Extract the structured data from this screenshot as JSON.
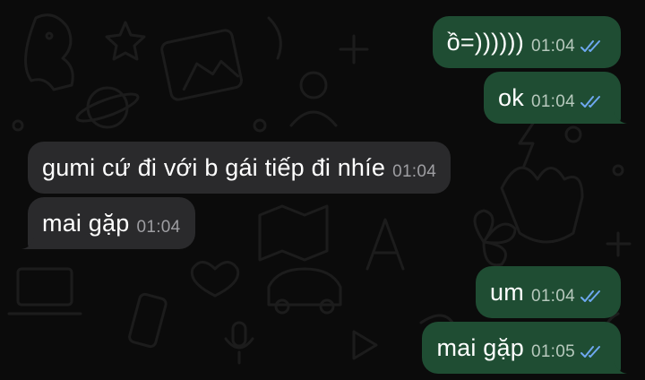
{
  "colors": {
    "background": "#0b0b0b",
    "outgoing_bubble": "#1f4d33",
    "incoming_bubble": "#2a2a2c",
    "read_checks": "#6ea8f0"
  },
  "messages": [
    {
      "direction": "outgoing",
      "text": "ồ=))))))",
      "time": "01:04",
      "status": "read"
    },
    {
      "direction": "outgoing",
      "text": "ok",
      "time": "01:04",
      "status": "read"
    },
    {
      "direction": "incoming",
      "text": "gumi cứ đi với b gái tiếp đi nhíe",
      "time": "01:04"
    },
    {
      "direction": "incoming",
      "text": "mai gặp",
      "time": "01:04"
    },
    {
      "direction": "outgoing",
      "text": "um",
      "time": "01:04",
      "status": "read"
    },
    {
      "direction": "outgoing",
      "text": "mai gặp",
      "time": "01:05",
      "status": "read"
    }
  ],
  "icons": {
    "read_receipt": "double-check-icon"
  }
}
